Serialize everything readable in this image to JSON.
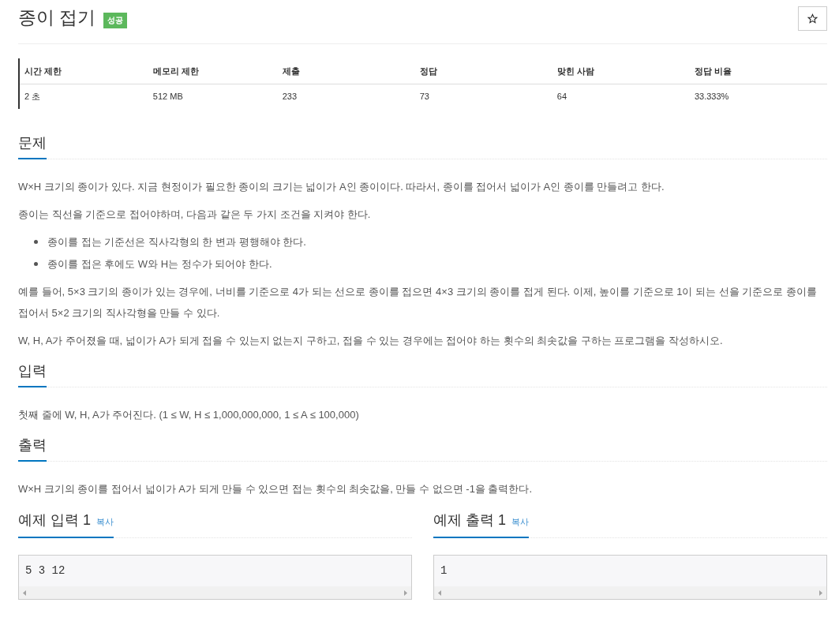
{
  "problem": {
    "title": "종이 접기",
    "status_badge": "성공"
  },
  "info_table": {
    "columns": [
      "시간 제한",
      "메모리 제한",
      "제출",
      "정답",
      "맞힌 사람",
      "정답 비율"
    ],
    "rows": [
      [
        "2 초",
        "512 MB",
        "233",
        "73",
        "64",
        "33.333%"
      ]
    ]
  },
  "sections": [
    {
      "heading": "문제",
      "blocks": [
        {
          "kind": "paragraph",
          "text": "W×H 크기의 종이가 있다. 지금 현정이가 필요한 종이의 크기는 넓이가 A인 종이이다. 따라서, 종이를 접어서 넓이가 A인 종이를 만들려고 한다."
        },
        {
          "kind": "paragraph",
          "text": "종이는 직선을 기준으로 접어야하며, 다음과 같은 두 가지 조건을 지켜야 한다."
        },
        {
          "kind": "bullets",
          "items": [
            "종이를 접는 기준선은 직사각형의 한 변과 평행해야 한다.",
            "종이를 접은 후에도 W와 H는 정수가 되어야 한다."
          ]
        },
        {
          "kind": "paragraph",
          "text": "예를 들어, 5×3 크기의 종이가 있는 경우에, 너비를 기준으로 4가 되는 선으로 종이를 접으면 4×3 크기의 종이를 접게 된다. 이제, 높이를 기준으로 1이 되는 선을 기준으로 종이를 접어서 5×2 크기의 직사각형을 만들 수 있다."
        },
        {
          "kind": "paragraph",
          "text": "W, H, A가 주어졌을 때, 넓이가 A가 되게 접을 수 있는지 없는지 구하고, 접을 수 있는 경우에는 접어야 하는 횟수의 최솟값을 구하는 프로그램을 작성하시오."
        }
      ]
    },
    {
      "heading": "입력",
      "blocks": [
        {
          "kind": "paragraph",
          "text": "첫째 줄에 W, H, A가 주어진다. (1 ≤ W, H ≤ 1,000,000,000, 1 ≤ A ≤ 100,000)"
        }
      ]
    },
    {
      "heading": "출력",
      "blocks": [
        {
          "kind": "paragraph",
          "text": "W×H 크기의 종이를 접어서 넓이가 A가 되게 만들 수 있으면 접는 횟수의 최솟값을, 만들 수 없으면 -1을 출력한다."
        }
      ]
    }
  ],
  "samples": [
    {
      "heading": "예제 입력 1",
      "copy_link": "복사",
      "content": "5 3 12"
    },
    {
      "heading": "예제 출력 1",
      "copy_link": "복사",
      "content": "1"
    }
  ]
}
